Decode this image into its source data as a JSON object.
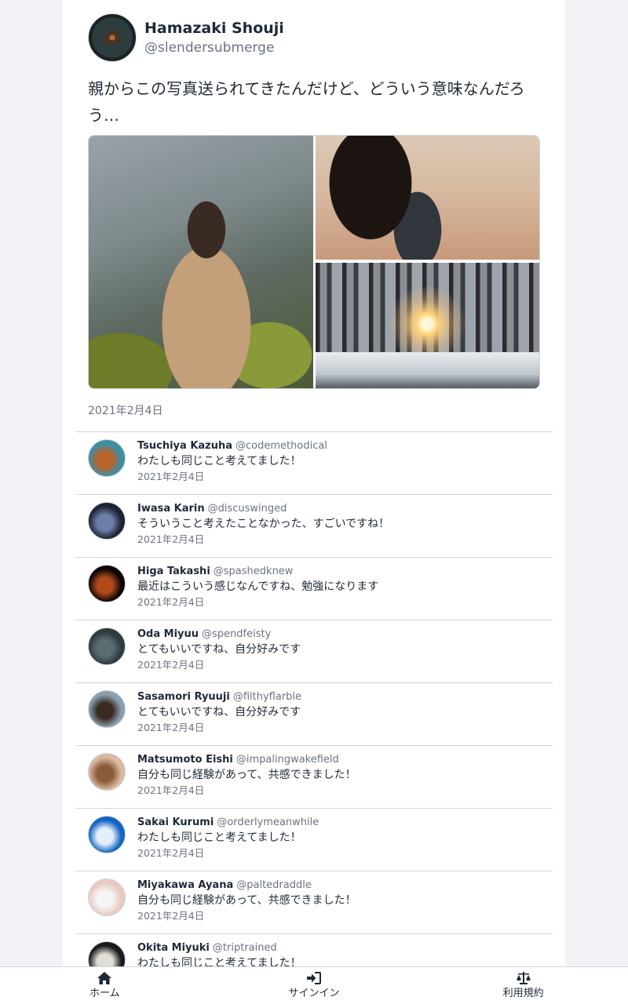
{
  "post": {
    "author_name": "Hamazaki Shouji",
    "author_handle": "@slendersubmerge",
    "text": "親からこの写真送られてきたんだけど、どういう意味なんだろう…",
    "date": "2021年2月4日",
    "images": [
      "man-in-suit-photo",
      "woman-hair-photo",
      "snowy-forest-sunrise-photo"
    ]
  },
  "replies": [
    {
      "name": "Tsuchiya Kazuha",
      "handle": "@codemethodical",
      "text": "わたしも同じこと考えてました！",
      "date": "2021年2月4日",
      "avatar_colors": [
        "#3b8fa5",
        "#b8642d"
      ]
    },
    {
      "name": "Iwasa Karin",
      "handle": "@discuswinged",
      "text": "そういうこと考えたことなかった、すごいですね！",
      "date": "2021年2月4日",
      "avatar_colors": [
        "#1f2233",
        "#6b7fa8"
      ]
    },
    {
      "name": "Higa Takashi",
      "handle": "@spashedknew",
      "text": "最近はこういう感じなんですね、勉強になります",
      "date": "2021年2月4日",
      "avatar_colors": [
        "#0d0606",
        "#b04a1a"
      ]
    },
    {
      "name": "Oda Miyuu",
      "handle": "@spendfeisty",
      "text": "とてもいいですね、自分好みです",
      "date": "2021年2月4日",
      "avatar_colors": [
        "#2d3a3e",
        "#5d6e72"
      ]
    },
    {
      "name": "Sasamori Ryuuji",
      "handle": "@filthyflarble",
      "text": "とてもいいですね、自分好みです",
      "date": "2021年2月4日",
      "avatar_colors": [
        "#8aa0b0",
        "#3b2a22"
      ]
    },
    {
      "name": "Matsumoto Eishi",
      "handle": "@impalingwakefield",
      "text": "自分も同じ経験があって、共感できました！",
      "date": "2021年2月4日",
      "avatar_colors": [
        "#d9b9a0",
        "#8a5a3a"
      ]
    },
    {
      "name": "Sakai Kurumi",
      "handle": "@orderlymeanwhile",
      "text": "わたしも同じこと考えてました！",
      "date": "2021年2月4日",
      "avatar_colors": [
        "#1565c0",
        "#e3f0fa"
      ]
    },
    {
      "name": "Miyakawa Ayana",
      "handle": "@paltedraddle",
      "text": "自分も同じ経験があって、共感できました！",
      "date": "2021年2月4日",
      "avatar_colors": [
        "#e8c9c0",
        "#f5f5f5"
      ]
    },
    {
      "name": "Okita Miyuki",
      "handle": "@triptrained",
      "text": "わたしも同じこと考えてました！",
      "date": "",
      "avatar_colors": [
        "#1a1a1a",
        "#e0ddd5"
      ]
    }
  ],
  "nav": {
    "home": {
      "label": "ホーム",
      "icon": "home-icon"
    },
    "signin": {
      "label": "サインイン",
      "icon": "sign-in-icon"
    },
    "terms": {
      "label": "利用規約",
      "icon": "balance-scale-icon"
    }
  }
}
